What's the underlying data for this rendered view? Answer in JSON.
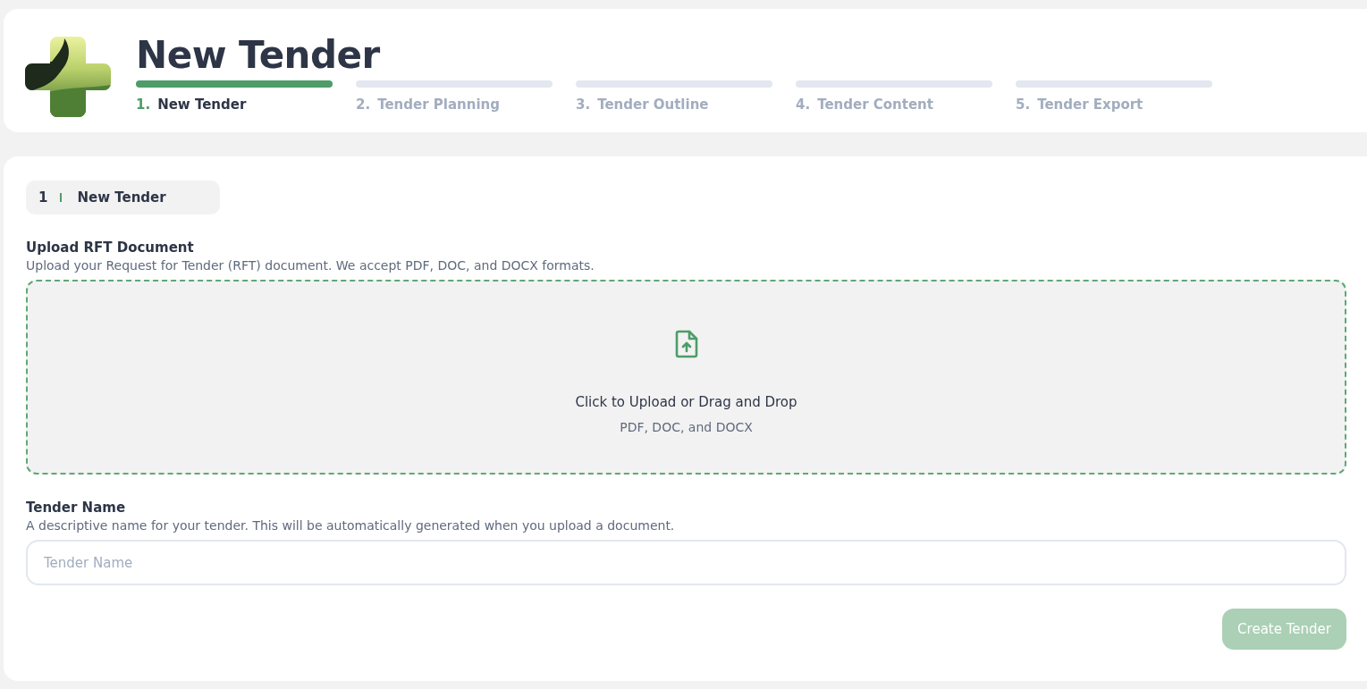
{
  "header": {
    "title": "New Tender",
    "steps": [
      {
        "number": "1.",
        "label": "New Tender",
        "selected": true
      },
      {
        "number": "2.",
        "label": "Tender Planning",
        "selected": false
      },
      {
        "number": "3.",
        "label": "Tender Outline",
        "selected": false
      },
      {
        "number": "4.",
        "label": "Tender Content",
        "selected": false
      },
      {
        "number": "5.",
        "label": "Tender Export",
        "selected": false
      }
    ]
  },
  "section": {
    "number": "1",
    "title": "New Tender"
  },
  "upload": {
    "label": "Upload RFT Document",
    "description": "Upload your Request for Tender (RFT) document. We accept PDF, DOC, and DOCX formats.",
    "prompt": "Click to Upload or Drag and Drop",
    "formats": "PDF, DOC, and DOCX"
  },
  "name_field": {
    "label": "Tender Name",
    "description": "A descriptive name for your tender. This will be automatically generated when you upload a document.",
    "placeholder": "Tender Name"
  },
  "button": {
    "label": "Create Tender",
    "disabled": true
  }
}
